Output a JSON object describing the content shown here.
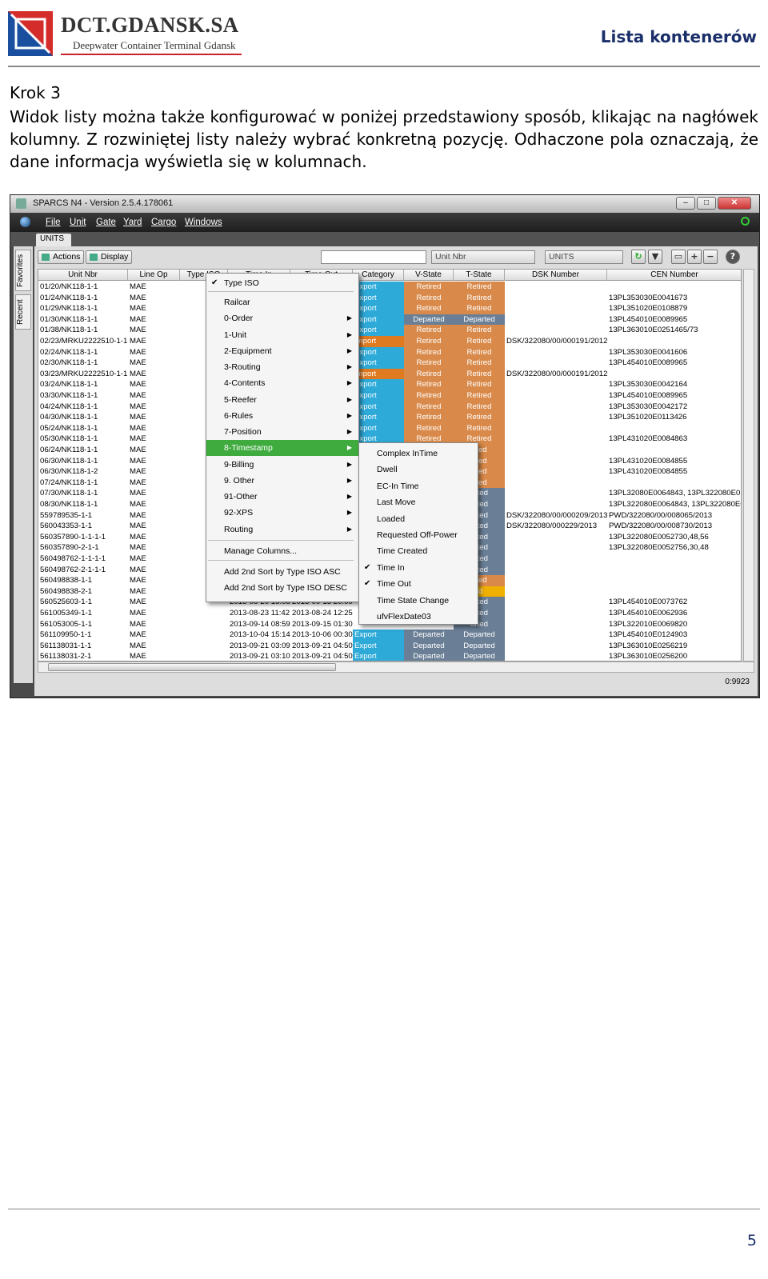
{
  "header": {
    "brand": "DCT.GDANSK.SA",
    "brand_subtitle": "Deepwater Container Terminal Gdansk",
    "doc_title": "Lista kontenerów",
    "colors": {
      "brand_red": "#c8202f",
      "brand_blue": "#1a2f6a"
    }
  },
  "body": {
    "step": "Krok 3",
    "paragraph": "Widok listy można także konfigurować w poniżej przedstawiony sposób, klikając na nagłówek kolumny. Z rozwiniętej listy należy wybrać konkretną pozycję. Odhaczone pola oznaczają, że dane informacja wyświetla się w kolumnach."
  },
  "app": {
    "window_title": "SPARCS N4 - Version 2.5.4.178061",
    "menu": [
      "File",
      "Unit",
      "Gate",
      "Yard",
      "Cargo",
      "Windows"
    ],
    "tab": "UNITS",
    "side_tabs": [
      "Favorites",
      "Recent"
    ],
    "toolbar": {
      "actions": "Actions",
      "display": "Display",
      "search_value": "",
      "field_select": "Unit Nbr",
      "entity_select": "UNITS"
    },
    "columns": [
      "Unit Nbr",
      "Line Op",
      "Type ISO",
      "Time In",
      "Time Out",
      "Category",
      "V-State",
      "T-State",
      "DSK Number",
      "CEN Number"
    ],
    "rows": [
      [
        "01/20/NK118-1-1",
        "MAE",
        "",
        "",
        "",
        "Export",
        "Retired",
        "Retired",
        "",
        ""
      ],
      [
        "01/24/NK118-1-1",
        "MAE",
        "",
        "",
        "",
        "Export",
        "Retired",
        "Retired",
        "",
        "13PL353030E0041673"
      ],
      [
        "01/29/NK118-1-1",
        "MAE",
        "",
        "",
        "",
        "Export",
        "Retired",
        "Retired",
        "",
        "13PL351020E0108879"
      ],
      [
        "01/30/NK118-1-1",
        "MAE",
        "",
        "",
        "",
        "Export",
        "Departed",
        "Departed",
        "",
        "13PL454010E0089965"
      ],
      [
        "01/38/NK118-1-1",
        "MAE",
        "",
        "",
        "",
        "Export",
        "Retired",
        "Retired",
        "",
        "13PL363010E0251465/73"
      ],
      [
        "02/23/MRKU2222510-1-1",
        "MAE",
        "",
        "",
        "",
        "Import",
        "Retired",
        "Retired",
        "DSK/322080/00/000191/2012",
        ""
      ],
      [
        "02/24/NK118-1-1",
        "MAE",
        "",
        "",
        "",
        "Export",
        "Retired",
        "Retired",
        "",
        "13PL353030E0041606"
      ],
      [
        "02/30/NK118-1-1",
        "MAE",
        "",
        "",
        "",
        "Export",
        "Retired",
        "Retired",
        "",
        "13PL454010E0089965"
      ],
      [
        "03/23/MRKU2222510-1-1",
        "MAE",
        "",
        "",
        "",
        "Import",
        "Retired",
        "Retired",
        "DSK/322080/00/000191/2012",
        ""
      ],
      [
        "03/24/NK118-1-1",
        "MAE",
        "",
        "",
        "",
        "Export",
        "Retired",
        "Retired",
        "",
        "13PL353030E0042164"
      ],
      [
        "03/30/NK118-1-1",
        "MAE",
        "",
        "",
        "",
        "Export",
        "Retired",
        "Retired",
        "",
        "13PL454010E0089965"
      ],
      [
        "04/24/NK118-1-1",
        "MAE",
        "",
        "",
        "",
        "Export",
        "Retired",
        "Retired",
        "",
        "13PL353030E0042172"
      ],
      [
        "04/30/NK118-1-1",
        "MAE",
        "",
        "",
        "",
        "Export",
        "Retired",
        "Retired",
        "",
        "13PL351020E0113426"
      ],
      [
        "05/24/NK118-1-1",
        "MAE",
        "",
        "",
        "",
        "Export",
        "Retired",
        "Retired",
        "",
        ""
      ],
      [
        "05/30/NK118-1-1",
        "MAE",
        "",
        "",
        "",
        "Export",
        "Retired",
        "Retired",
        "",
        "13PL431020E0084863"
      ],
      [
        "06/24/NK118-1-1",
        "MAE",
        "",
        "",
        "",
        "",
        "",
        "rired",
        "",
        ""
      ],
      [
        "06/30/NK118-1-1",
        "MAE",
        "",
        "",
        "",
        "",
        "",
        "rired",
        "",
        "13PL431020E0084855"
      ],
      [
        "06/30/NK118-1-2",
        "MAE",
        "",
        "",
        "",
        "",
        "",
        "rired",
        "",
        "13PL431020E0084855"
      ],
      [
        "07/24/NK118-1-1",
        "MAE",
        "",
        "",
        "",
        "",
        "",
        "rired",
        "",
        ""
      ],
      [
        "07/30/NK118-1-1",
        "MAE",
        "",
        "",
        "",
        "",
        "",
        "arted",
        "",
        "13PL32080E0064843, 13PL322080E0"
      ],
      [
        "08/30/NK118-1-1",
        "MAE",
        "",
        "",
        "",
        "",
        "",
        "arted",
        "",
        "13PL322080E0064843, 13PL322080E0"
      ],
      [
        "559789535-1-1",
        "MAE",
        "",
        "",
        "",
        "",
        "",
        "arted",
        "DSK/322080/00/000209/2013",
        "PWD/322080/00/008065/2013"
      ],
      [
        "560043353-1-1",
        "MAE",
        "",
        "",
        "",
        "",
        "",
        "arted",
        "DSK/322080/000229/2013",
        "PWD/322080/00/008730/2013"
      ],
      [
        "560357890-1-1-1-1",
        "MAE",
        "",
        "",
        "",
        "",
        "",
        "arted",
        "",
        "13PL322080E0052730,48,56"
      ],
      [
        "560357890-2-1-1",
        "MAE",
        "",
        "",
        "",
        "",
        "",
        "arted",
        "",
        "13PL322080E0052756,30,48"
      ],
      [
        "560498762-1-1-1-1",
        "MAE",
        "",
        "",
        "",
        "",
        "",
        "arted",
        "",
        ""
      ],
      [
        "560498762-2-1-1-1",
        "MAE",
        "",
        "",
        "",
        "",
        "",
        "arted",
        "",
        ""
      ],
      [
        "560498838-1-1",
        "MAE",
        "",
        "",
        "",
        "",
        "",
        "rired",
        "",
        ""
      ],
      [
        "560498838-2-1",
        "MAE",
        "",
        "",
        "",
        "",
        "",
        "rd",
        "",
        ""
      ],
      [
        "560525603-1-1",
        "MAE",
        "",
        "2013-08-20 15:08",
        "2013-09-13 20:00",
        "",
        "",
        "arted",
        "",
        "13PL454010E0073762"
      ],
      [
        "561005349-1-1",
        "MAE",
        "",
        "2013-08-23 11:42",
        "2013-08-24 12:25",
        "",
        "",
        "arted",
        "",
        "13PL454010E0062936"
      ],
      [
        "561053005-1-1",
        "MAE",
        "",
        "2013-09-14 08:59",
        "2013-09-15 01:30",
        "",
        "",
        "arted",
        "",
        "13PL322010E0069820"
      ],
      [
        "561109950-1-1",
        "MAE",
        "",
        "2013-10-04 15:14",
        "2013-10-06 00:30",
        "Export",
        "Departed",
        "Departed",
        "",
        "13PL454010E0124903"
      ],
      [
        "561138031-1-1",
        "MAE",
        "",
        "2013-09-21 03:09",
        "2013-09-21 04:50",
        "Export",
        "Departed",
        "Departed",
        "",
        "13PL363010E0256219"
      ],
      [
        "561138031-2-1",
        "MAE",
        "",
        "2013-09-21 03:10",
        "2013-09-21 04:50",
        "Export",
        "Departed",
        "Departed",
        "",
        "13PL363010E0256200"
      ]
    ],
    "record_count": "0:9923",
    "context_menu": {
      "items": [
        {
          "label": "Type ISO",
          "checked": true,
          "submenu": false
        },
        {
          "label": "Railcar",
          "checked": false,
          "submenu": false
        },
        {
          "label": "0-Order",
          "checked": false,
          "submenu": true
        },
        {
          "label": "1-Unit",
          "checked": false,
          "submenu": true
        },
        {
          "label": "2-Equipment",
          "checked": false,
          "submenu": true
        },
        {
          "label": "3-Routing",
          "checked": false,
          "submenu": true
        },
        {
          "label": "4-Contents",
          "checked": false,
          "submenu": true
        },
        {
          "label": "5-Reefer",
          "checked": false,
          "submenu": true
        },
        {
          "label": "6-Rules",
          "checked": false,
          "submenu": true
        },
        {
          "label": "7-Position",
          "checked": false,
          "submenu": true
        },
        {
          "label": "8-Timestamp",
          "checked": false,
          "submenu": true,
          "highlighted": true
        },
        {
          "label": "9-Billing",
          "checked": false,
          "submenu": true
        },
        {
          "label": "9. Other",
          "checked": false,
          "submenu": true
        },
        {
          "label": "91-Other",
          "checked": false,
          "submenu": true
        },
        {
          "label": "92-XPS",
          "checked": false,
          "submenu": true
        },
        {
          "label": "Routing",
          "checked": false,
          "submenu": true
        },
        {
          "label": "Manage Columns...",
          "checked": false,
          "submenu": false
        },
        {
          "label": "Add 2nd Sort by Type ISO ASC",
          "checked": false,
          "submenu": false
        },
        {
          "label": "Add 2nd Sort by Type ISO DESC",
          "checked": false,
          "submenu": false
        }
      ]
    },
    "submenu": {
      "items": [
        {
          "label": "Complex InTime",
          "checked": false
        },
        {
          "label": "Dwell",
          "checked": false
        },
        {
          "label": "EC-In Time",
          "checked": false
        },
        {
          "label": "Last Move",
          "checked": false
        },
        {
          "label": "Loaded",
          "checked": false
        },
        {
          "label": "Requested Off-Power",
          "checked": false
        },
        {
          "label": "Time Created",
          "checked": false
        },
        {
          "label": "Time In",
          "checked": true
        },
        {
          "label": "Time Out",
          "checked": true
        },
        {
          "label": "Time State Change",
          "checked": false
        },
        {
          "label": "ufvFlexDate03",
          "checked": false
        }
      ]
    },
    "colors": {
      "export": "#2eaad8",
      "import": "#e07a20",
      "retired": "#d98a4a",
      "departed": "#6a7f96",
      "highlight": "#3fab3f"
    }
  },
  "footer": {
    "page_number": "5"
  }
}
